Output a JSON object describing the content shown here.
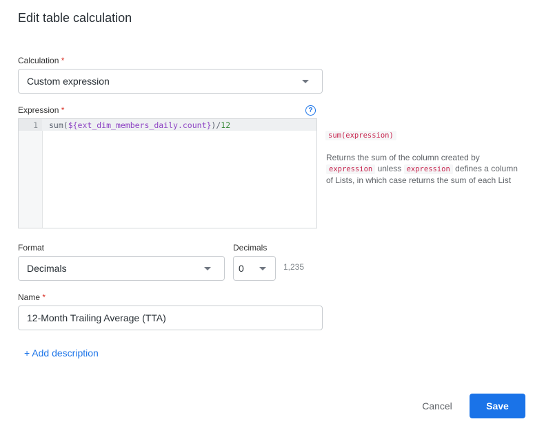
{
  "dialog": {
    "title": "Edit table calculation"
  },
  "calculation": {
    "label": "Calculation",
    "required_mark": "*",
    "value": "Custom expression"
  },
  "expression": {
    "label": "Expression",
    "required_mark": "*",
    "help_glyph": "?",
    "line_number": "1",
    "code": {
      "fn": "sum(",
      "field": "${ext_dim_members_daily.count}",
      "close_div": ")/",
      "number": "12"
    }
  },
  "function_help": {
    "signature": "sum(expression)",
    "desc_part1": "Returns the sum of the column created by",
    "arg": "expression",
    "desc_part2": "unless",
    "arg2": "expression",
    "desc_part3": "defines a column of Lists, in which case returns the sum of each List"
  },
  "format": {
    "label": "Format",
    "value": "Decimals"
  },
  "decimals": {
    "label": "Decimals",
    "value": "0",
    "preview": "1,235"
  },
  "name": {
    "label": "Name",
    "required_mark": "*",
    "value": "12-Month Trailing Average (TTA)"
  },
  "add_description": {
    "label": "+ Add description"
  },
  "footer": {
    "cancel": "Cancel",
    "save": "Save"
  }
}
